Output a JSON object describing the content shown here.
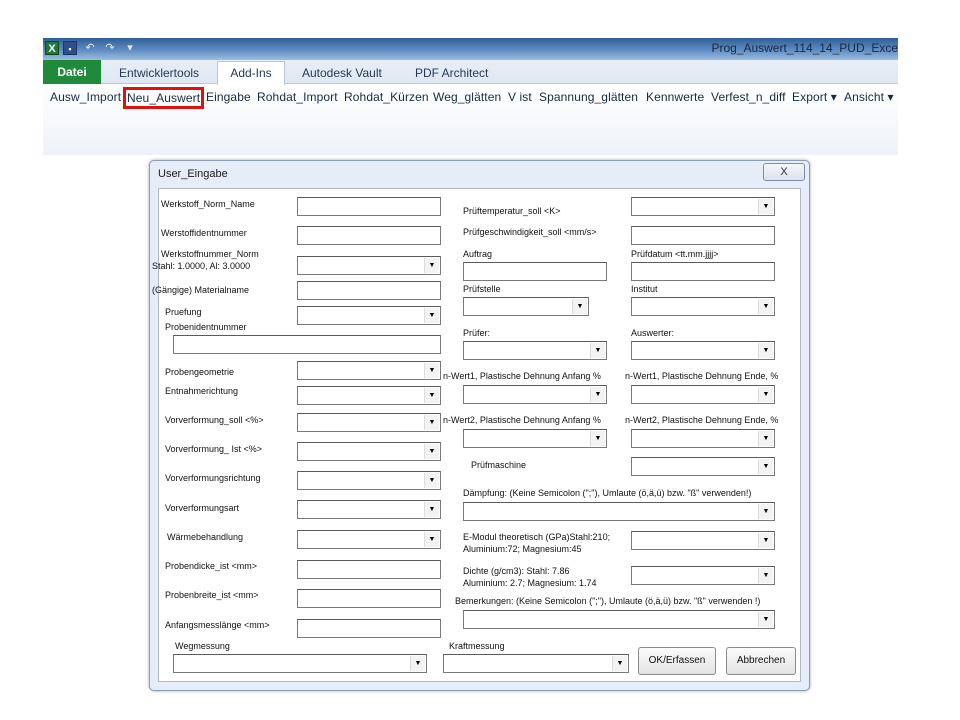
{
  "window": {
    "title": "Prog_Auswert_114_14_PUD_Exce"
  },
  "quick_access": {
    "excel_icon": "X",
    "save_icon": "▪",
    "undo_icon": "↶",
    "redo_icon": "↷",
    "menu_icon": "▾"
  },
  "tabs": {
    "file": "Datei",
    "developer": "Entwicklertools",
    "addins": "Add-Ins",
    "vault": "Autodesk Vault",
    "pdf": "PDF Architect"
  },
  "ribbon": {
    "ausw_import": "Ausw_Import",
    "neu_auswert": "Neu_Auswert",
    "eingabe": "Eingabe",
    "rohdat_import": "Rohdat_Import",
    "rohdat_kuerzen": "Rohdat_Kürzen",
    "weg_glaetten": "Weg_glätten",
    "v_ist": "V ist",
    "spannung_glaetten": "Spannung_glätten",
    "kennwerte": "Kennwerte",
    "verfest_n_diff": "Verfest_n_diff",
    "export": "Export ▾",
    "ansicht": "Ansicht ▾"
  },
  "dialog": {
    "title": "User_Eingabe",
    "close": "X",
    "labels": {
      "werkstoff_norm_name": "Werkstoff_Norm_Name",
      "werstoffidentnummer": "Werstoffidentnummer",
      "werkstoffnummer_norm_1": "Werkstoffnummer_Norm",
      "werkstoffnummer_norm_2": "Stahl: 1.0000, Al: 3.0000",
      "materialname": "(Gängige) Materialname",
      "pruefung": "Pruefung",
      "probenidentnummer": "Probenidentnummer",
      "probengeometrie": "Probengeometrie",
      "entnahmerichtung": "Entnahmerichtung",
      "vorverformung_soll": "Vorverformung_soll <%>",
      "vorverformung_ist": "Vorverformung_ Ist <%>",
      "vorverformungsrichtung": "Vorverformungsrichtung",
      "vorverformungsart": "Vorverformungsart",
      "waermebehandlung": "Wärmebehandlung",
      "probendicke": "Probendicke_ist <mm>",
      "probenbreite": "Probenbreite_ist <mm>",
      "anfangsmesslaenge": "Anfangsmesslänge <mm>",
      "wegmessung": "Wegmessung",
      "kraftmessung": "Kraftmessung",
      "prueftemperatur": "Prüftemperatur_soll <K>",
      "pruefgeschwindigkeit": "Prüfgeschwindigkeit_soll <mm/s>",
      "auftrag": "Auftrag",
      "pruefdatum": "Prüfdatum <tt.mm.jjjj>",
      "pruefstelle": "Prüfstelle",
      "institut": "Institut",
      "pruefer": "Prüfer:",
      "auswerter": "Auswerter:",
      "n_wert1_anfang": "n-Wert1, Plastische Dehnung Anfang %",
      "n_wert1_ende": "n-Wert1, Plastische Dehnung Ende, %",
      "n_wert2_anfang": "n-Wert2, Plastische Dehnung Anfang %",
      "n_wert2_ende": "n-Wert2, Plastische Dehnung Ende, %",
      "pruefmaschine": "Prüfmaschine",
      "daempfung": "Dämpfung: (Keine Semicolon  (\";\"), Umlaute (ö,ä,ü) bzw. \"ß\" verwenden!)",
      "emodul_1": "E-Modul theoretisch (GPa)Stahl:210;",
      "emodul_2": "Aluminium:72; Magnesium:45",
      "dichte_1": "Dichte (g/cm3): Stahl: 7.86",
      "dichte_2": "Aluminium: 2.7; Magnesium: 1.74",
      "bemerkungen": "Bemerkungen: (Keine Semicolon  (\";\"), Umlaute (ö,ä,ü) bzw. \"ß\" verwenden !)"
    },
    "buttons": {
      "ok": "OK/Erfassen",
      "cancel": "Abbrechen"
    }
  }
}
